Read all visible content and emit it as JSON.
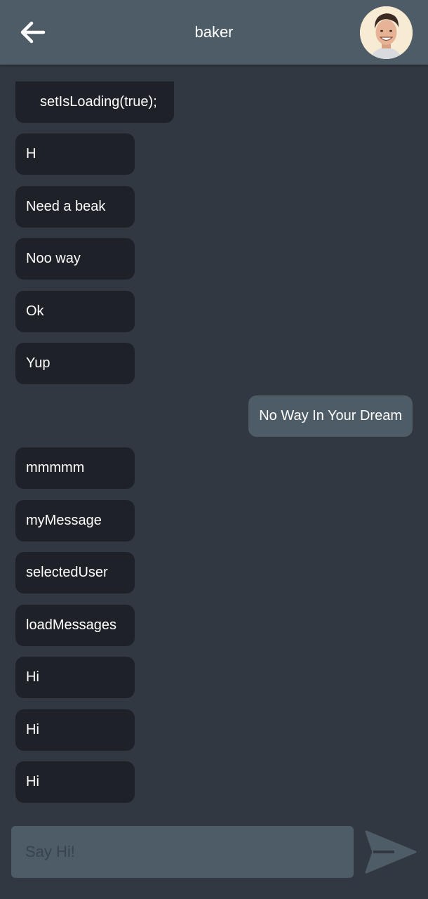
{
  "header": {
    "title": "baker"
  },
  "messages": [
    {
      "text": "setIsLoading(true);",
      "side": "incoming"
    },
    {
      "text": "H",
      "side": "incoming"
    },
    {
      "text": "Need a beak",
      "side": "incoming"
    },
    {
      "text": "Noo way",
      "side": "incoming"
    },
    {
      "text": "Ok",
      "side": "incoming"
    },
    {
      "text": "Yup",
      "side": "incoming"
    },
    {
      "text": "No Way In Your Dream",
      "side": "outgoing"
    },
    {
      "text": "mmmmm",
      "side": "incoming"
    },
    {
      "text": "myMessage",
      "side": "incoming"
    },
    {
      "text": "selectedUser",
      "side": "incoming"
    },
    {
      "text": "loadMessages",
      "side": "incoming"
    },
    {
      "text": "Hi",
      "side": "incoming"
    },
    {
      "text": "Hi",
      "side": "incoming"
    },
    {
      "text": "Hi",
      "side": "incoming"
    }
  ],
  "composer": {
    "value": "",
    "placeholder": "Say Hi!"
  },
  "icons": {
    "back": "arrow-left-icon",
    "send": "send-icon",
    "avatar": "user-avatar"
  },
  "colors": {
    "header_bg": "#4e5c67",
    "chat_bg": "#323841",
    "incoming_bubble": "#1e2128",
    "outgoing_bubble": "#4e5c67"
  }
}
